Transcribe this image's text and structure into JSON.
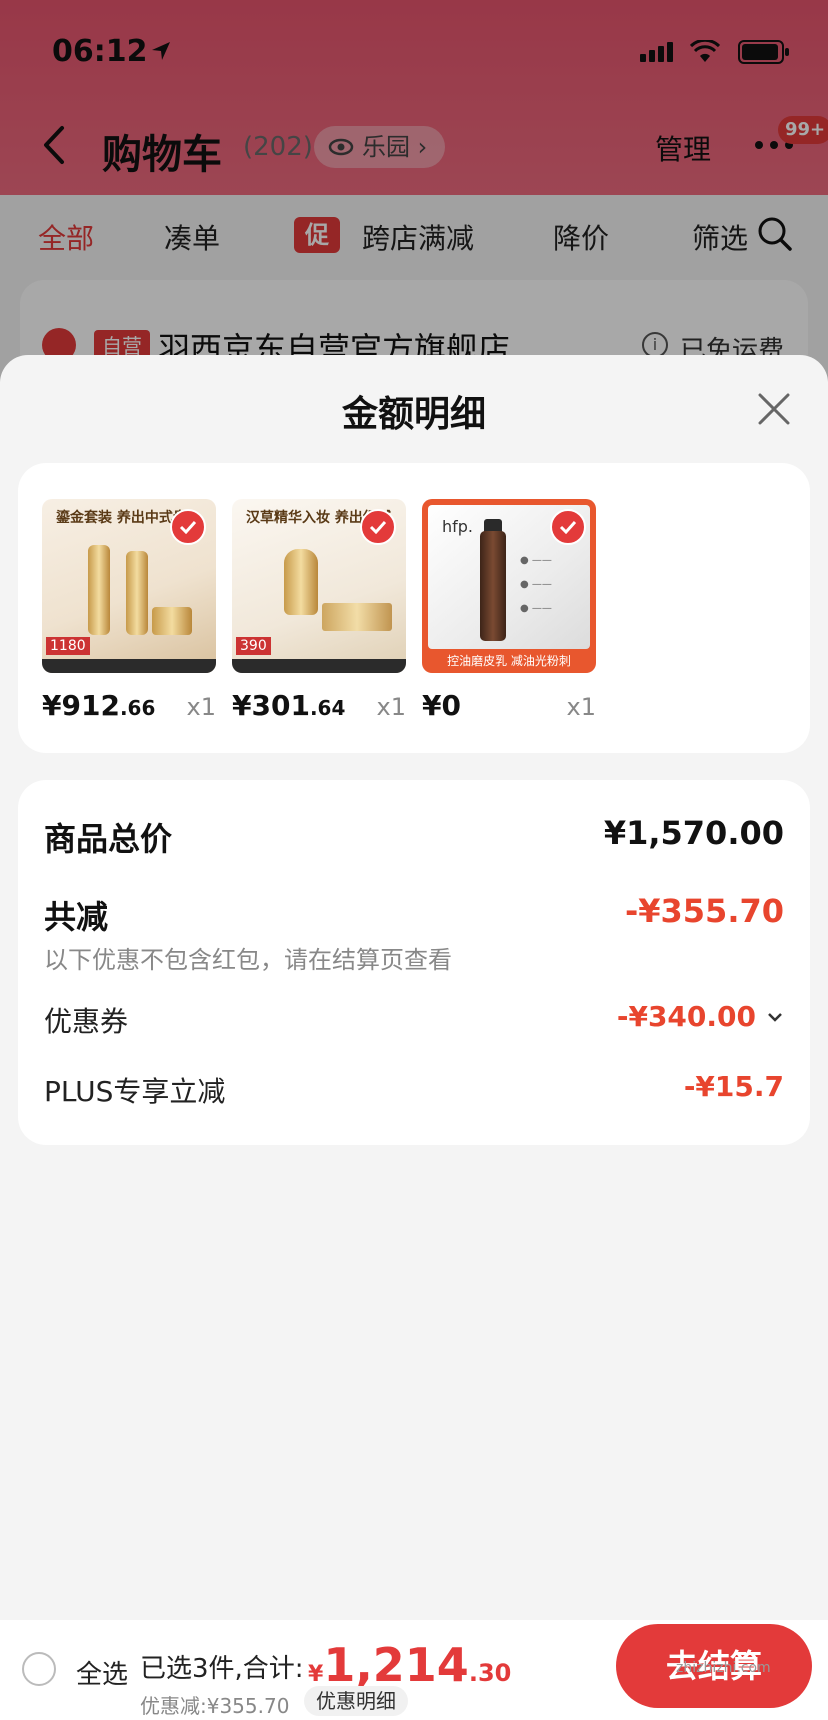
{
  "status_bar": {
    "time": "06:12"
  },
  "nav": {
    "title": "购物车",
    "count": "(202)",
    "park_label": "乐园",
    "manage_label": "管理",
    "badge": "99+"
  },
  "tabs": [
    {
      "label": "全部",
      "active": true
    },
    {
      "label": "凑单"
    },
    {
      "label": "跨店满减",
      "badge": "促"
    },
    {
      "label": "降价"
    },
    {
      "label": "筛选"
    }
  ],
  "store": {
    "badge": "自营",
    "name": "羽西京东自营官方旗舰店",
    "shipping": "已免运费"
  },
  "sheet": {
    "title": "金额明细",
    "products": [
      {
        "price_int": "¥912",
        "price_dec": ".66",
        "qty": "x1",
        "headline": "鎏金套装 养出中式贵",
        "tag": "1180"
      },
      {
        "price_int": "¥301",
        "price_dec": ".64",
        "qty": "x1",
        "headline": "汉草精华入妆 养出细腻",
        "tag": "390"
      },
      {
        "price_int": "¥0",
        "price_dec": "",
        "qty": "x1",
        "brand": "hfp.",
        "caption": "控油磨皮乳 减油光粉刺"
      }
    ],
    "summary": {
      "total_label": "商品总价",
      "total_value": "¥1,570.00",
      "minus_label": "共减",
      "minus_value": "-¥355.70",
      "note": "以下优惠不包含红包，请在结算页查看",
      "coupon_label": "优惠券",
      "coupon_value": "-¥340.00",
      "plus_label": "PLUS专享立减",
      "plus_value": "-¥15.7"
    }
  },
  "bottom": {
    "select_all": "全选",
    "selected_text": "已选3件,合计:",
    "currency": "¥",
    "total_int": "1,214",
    "total_dec": ".30",
    "discount_text": "优惠减:¥355.70",
    "detail_label": "优惠明细",
    "checkout_label": "去结算"
  },
  "watermark": "zhizhizhi.com",
  "colors": {
    "accent": "#e33a3a",
    "discount": "#e8452e"
  }
}
